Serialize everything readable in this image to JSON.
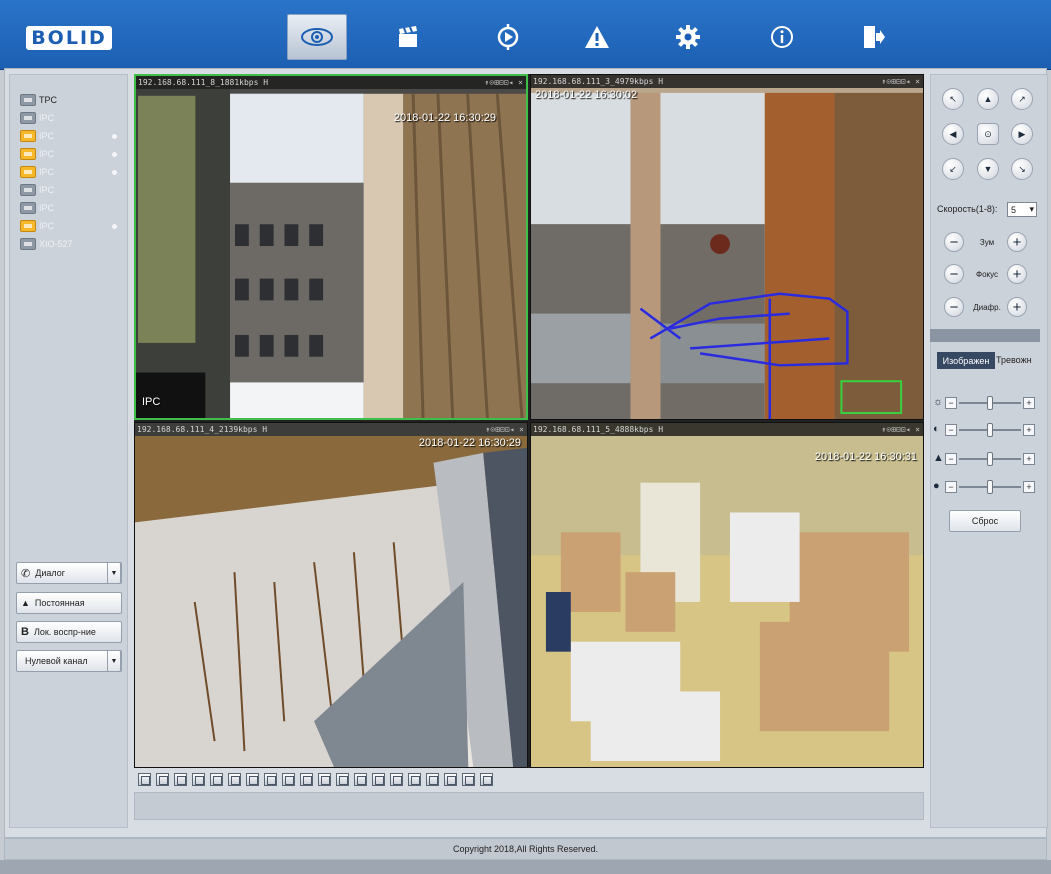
{
  "header": {
    "logo": "BOLID",
    "nav": [
      {
        "icon": "eye-icon",
        "active": true
      },
      {
        "icon": "clapperboard-icon",
        "active": false
      },
      {
        "icon": "target-play-icon",
        "active": false
      },
      {
        "icon": "warning-icon",
        "active": false
      },
      {
        "icon": "gear-icon",
        "active": false
      },
      {
        "icon": "info-icon",
        "active": false
      },
      {
        "icon": "logout-icon",
        "active": false
      }
    ]
  },
  "devices": [
    {
      "label": "TPC",
      "online": false,
      "dot": false
    },
    {
      "label": "IPC",
      "online": false,
      "dot": false
    },
    {
      "label": "IPC",
      "online": true,
      "dot": true
    },
    {
      "label": "IPC",
      "online": true,
      "dot": true
    },
    {
      "label": "IPC",
      "online": true,
      "dot": true
    },
    {
      "label": "IPC",
      "online": false,
      "dot": false
    },
    {
      "label": "IPC",
      "online": false,
      "dot": false
    },
    {
      "label": "IPC",
      "online": true,
      "dot": true
    },
    {
      "label": "XIO-527",
      "online": false,
      "dot": false
    }
  ],
  "left_buttons": {
    "talk": "Диалог",
    "record": "Постоянная",
    "local_playback": "Лок. воспр-ние",
    "zero_channel": "Нулевой канал"
  },
  "tiles": [
    {
      "bar": "192.168.68.111_8_1881kbps H",
      "timestamp": "2018-01-22 16:30:29",
      "label": "IPC",
      "selected": true
    },
    {
      "bar": "192.168.68.111_3_4979kbps H",
      "timestamp": "2018-01-22 16:30:02",
      "label": "",
      "selected": false
    },
    {
      "bar": "192.168.68.111_4_2139kbps H",
      "timestamp": "2018-01-22 16:30:29",
      "label": "",
      "selected": false
    },
    {
      "bar": "192.168.68.111_5_4888kbps H",
      "timestamp": "2018-01-22 16:30:31",
      "label": "",
      "selected": false
    }
  ],
  "tile_controls": "↟⊙⊞⊟⊡◂ ×",
  "layout_buttons": 16,
  "ptz": {
    "arrows": [
      "↖",
      "▲",
      "↗",
      "◀",
      "⊙",
      "▶",
      "↙",
      "▼",
      "↘"
    ],
    "speed_label": "Скорость(1-8):",
    "speed_value": "5",
    "zoom": "Зум",
    "focus": "Фокус",
    "iris": "Диафр."
  },
  "tabs": {
    "image": "Изображен",
    "alarm": "Тревожн"
  },
  "image_sliders": [
    {
      "icon": "brightness-icon",
      "symbol": "☼",
      "level": 0.5
    },
    {
      "icon": "contrast-icon",
      "symbol": "◐",
      "level": 0.5
    },
    {
      "icon": "saturation-icon",
      "symbol": "▲",
      "level": 0.5
    },
    {
      "icon": "hue-icon",
      "symbol": "●",
      "level": 0.5
    }
  ],
  "reset_label": "Сброс",
  "footer": "Copyright 2018,All Rights Reserved."
}
